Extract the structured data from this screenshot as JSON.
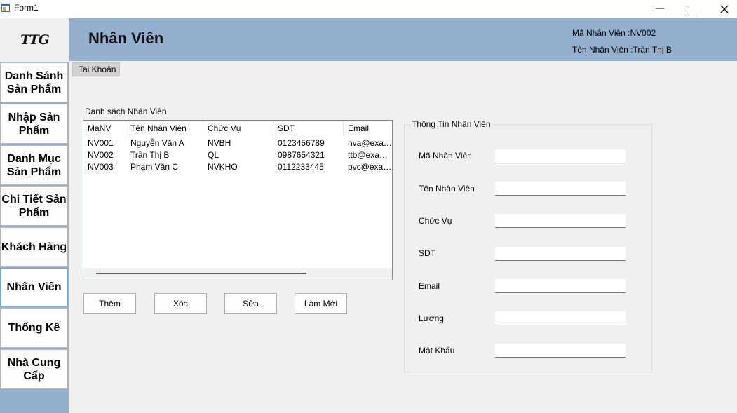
{
  "window": {
    "title": "Form1",
    "minimize": "—"
  },
  "logo": {
    "text": "TTG"
  },
  "sidebar": {
    "items": [
      {
        "label": "Danh Sánh Sản Phẩm"
      },
      {
        "label": "Nhập Sản Phẩm"
      },
      {
        "label": "Danh Mục Sản Phẩm"
      },
      {
        "label": "Chi Tiết Sản Phẩm"
      },
      {
        "label": "Khách Hàng"
      },
      {
        "label": "Nhân Viên"
      },
      {
        "label": "Thống Kê"
      },
      {
        "label": "Nhà Cung Cấp"
      }
    ],
    "active_index": 5
  },
  "header": {
    "title": "Nhân Viên",
    "employee_id": "Mã Nhân Viên :NV002",
    "employee_name": "Tên Nhân Viên :Trần Thị B",
    "color": "#95afcf"
  },
  "tab": {
    "label": "Tai Khoản"
  },
  "list": {
    "caption": "Danh sách Nhân Viên",
    "columns": [
      "MaNV",
      "Tên Nhân Viên",
      "Chức Vụ",
      "SDT",
      "Email"
    ],
    "rows": [
      [
        "NV001",
        "Nguyễn Văn A",
        "NVBH",
        "0123456789",
        "nva@exam..."
      ],
      [
        "NV002",
        "Trần Thị B",
        "QL",
        "0987654321",
        "ttb@exampl..."
      ],
      [
        "NV003",
        "Phạm Văn C",
        "NVKHO",
        "0112233445",
        "pvc@exam..."
      ]
    ]
  },
  "actions": {
    "add": "Thêm",
    "delete": "Xóa",
    "edit": "Sửa",
    "reset": "Làm Mới"
  },
  "form": {
    "legend": "Thông Tin Nhân Viên",
    "fields": [
      {
        "label": "Mã Nhân Viên",
        "value": ""
      },
      {
        "label": "Tên Nhân Viên",
        "value": ""
      },
      {
        "label": "Chức Vụ",
        "value": ""
      },
      {
        "label": "SDT",
        "value": ""
      },
      {
        "label": "Email",
        "value": ""
      },
      {
        "label": "Lương",
        "value": ""
      },
      {
        "label": "Mật Khẩu",
        "value": ""
      }
    ]
  }
}
